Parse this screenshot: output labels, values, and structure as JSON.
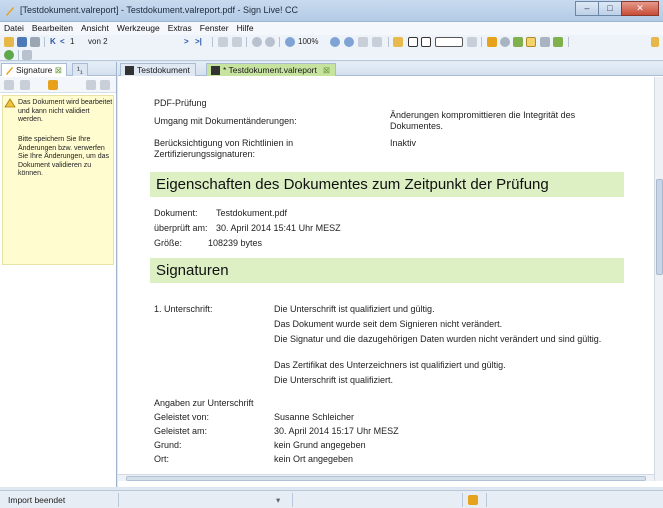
{
  "window": {
    "title": "[Testdokument.valreport] - Testdokument.valreport.pdf - Sign Live! CC"
  },
  "menu": [
    "Datei",
    "Bearbeiten",
    "Ansicht",
    "Werkzeuge",
    "Extras",
    "Fenster",
    "Hilfe"
  ],
  "toolbar": {
    "page_current": "1",
    "page_total": "von 2",
    "zoom": "100%"
  },
  "left_panel": {
    "tab_signature": "Signature",
    "tab_other": "¹₁",
    "message_1": "Das Dokument wird bearbeitet und kann nicht validiert werden.",
    "message_2": "Bitte speichern Sie Ihre Änderungen bzw. verwerfen Sie Ihre Änderungen, um das Dokument validieren zu können."
  },
  "doc_tabs": [
    "Testdokument",
    "* Testdokument.valreport"
  ],
  "report": {
    "pdf_check": "PDF-Prüfung",
    "row1_label": "Umgang mit Dokumentänderungen:",
    "row1_value": "Änderungen kompromittieren die Integrität des Dokumentes.",
    "row2_label": "Berücksichtigung von Richtlinien in Zertifizierungssignaturen:",
    "row2_value": "Inaktiv",
    "section_props": "Eigenschaften des Dokumentes zum Zeitpunkt der Prüfung",
    "doc_label": "Dokument:",
    "doc_value": "Testdokument.pdf",
    "checked_label": "überprüft am:",
    "checked_value": "30. April 2014 15:41 Uhr MESZ",
    "size_label": "Größe:",
    "size_value": "108239 bytes",
    "section_sigs": "Signaturen",
    "sig_label": "1. Unterschrift:",
    "sig_lines": [
      "Die Unterschrift ist qualifiziert und gültig.",
      "Das Dokument wurde seit dem Signieren nicht verändert.",
      "Die Signatur und die dazugehörigen Daten wurden nicht verändert und sind gültig.",
      "Das Zertifikat des Unterzeichners ist qualifiziert und gültig.",
      "Die Unterschrift ist qualifiziert."
    ],
    "details_title": "Angaben zur Unterschrift",
    "by_label": "Geleistet von:",
    "by_value": "Susanne Schleicher",
    "at_label": "Geleistet am:",
    "at_value": "30. April 2014 15:17 Uhr MESZ",
    "reason_label": "Grund:",
    "reason_value": "kein Grund angegeben",
    "place_label": "Ort:",
    "place_value": "kein Ort angegeben"
  },
  "status": {
    "text": "Import beendet"
  },
  "icons": [
    "app-icon",
    "open-icon",
    "save-icon",
    "print-icon",
    "first-page-icon",
    "prev-page-icon",
    "next-page-icon",
    "last-page-icon",
    "zoom-icon",
    "signature-icon",
    "warning-icon"
  ]
}
